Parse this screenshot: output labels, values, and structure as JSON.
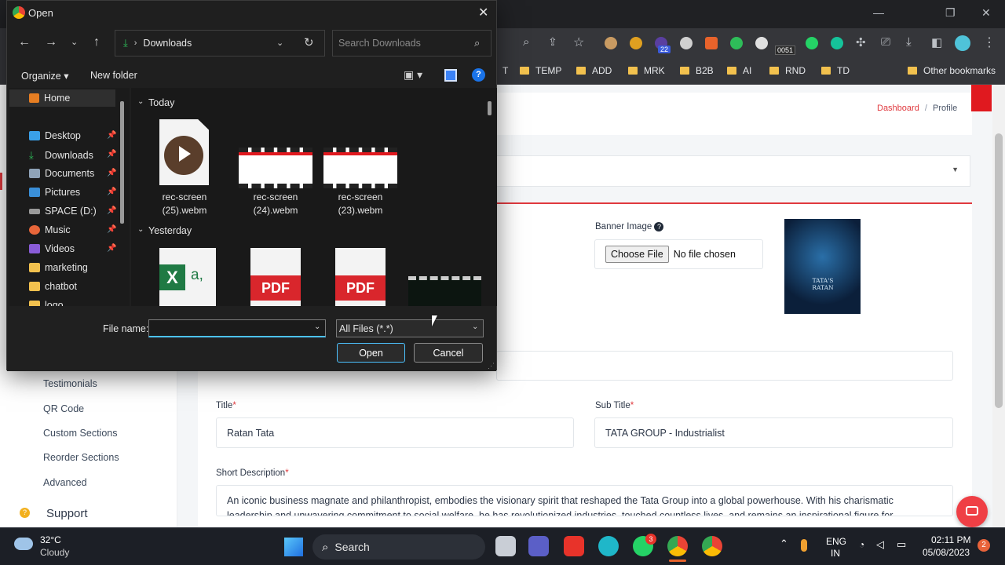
{
  "browser": {
    "bookmarks": [
      "TEMP",
      "ADD",
      "MRK",
      "B2B",
      "AI",
      "RND",
      "TD",
      "Other bookmarks"
    ],
    "bookmark_partial": "T",
    "extension_badges": {
      "purple": "22",
      "counter": "0051"
    }
  },
  "page": {
    "breadcrumb": {
      "dashboard": "Dashboard",
      "sep": "/",
      "current": "Profile"
    },
    "banner": {
      "label": "Banner Image",
      "help": "?",
      "button": "Choose File",
      "status": "No file chosen"
    },
    "banner_preview_text": "TATA'S RATAN",
    "title": {
      "label": "Title",
      "required": "*",
      "value": "Ratan Tata"
    },
    "subtitle": {
      "label": "Sub Title",
      "required": "*",
      "value": "TATA GROUP - Industrialist"
    },
    "short_description": {
      "label": "Short Description",
      "required": "*",
      "line1": "An iconic business magnate and philanthropist, embodies the visionary spirit that reshaped the Tata Group into a global powerhouse. With his charismatic",
      "line2": "leadership and unwavering commitment to social welfare, he has revolutionized industries, touched countless lives, and remains an inspirational figure for"
    },
    "sidebar": {
      "items": [
        "Testimonials",
        "QR Code",
        "Custom Sections",
        "Reorder Sections",
        "Advanced"
      ],
      "support": "Support"
    }
  },
  "dialog": {
    "title": "Open",
    "path": "Downloads",
    "search_placeholder": "Search Downloads",
    "organize": "Organize",
    "new_folder": "New folder",
    "nav": {
      "home": "Home",
      "items": [
        "Desktop",
        "Downloads",
        "Documents",
        "Pictures",
        "SPACE (D:)",
        "Music",
        "Videos",
        "marketing",
        "chatbot",
        "logo"
      ]
    },
    "groups": {
      "today": "Today",
      "yesterday": "Yesterday"
    },
    "files_today": [
      {
        "name1": "rec-screen",
        "name2": "(25).webm"
      },
      {
        "name1": "rec-screen",
        "name2": "(24).webm"
      },
      {
        "name1": "rec-screen",
        "name2": "(23).webm"
      }
    ],
    "pdf_label": "PDF",
    "excel_letter": "X",
    "excel_suffix": "a,",
    "file_name_label": "File name:",
    "file_name_value": "",
    "filter": "All Files (*.*)",
    "open_button": "Open",
    "cancel_button": "Cancel"
  },
  "taskbar": {
    "weather": {
      "temp": "32°C",
      "desc": "Cloudy"
    },
    "search": "Search",
    "lang": {
      "line1": "ENG",
      "line2": "IN"
    },
    "time": "02:11 PM",
    "date": "05/08/2023",
    "notifications": "2",
    "whatsapp_badge": "3"
  }
}
